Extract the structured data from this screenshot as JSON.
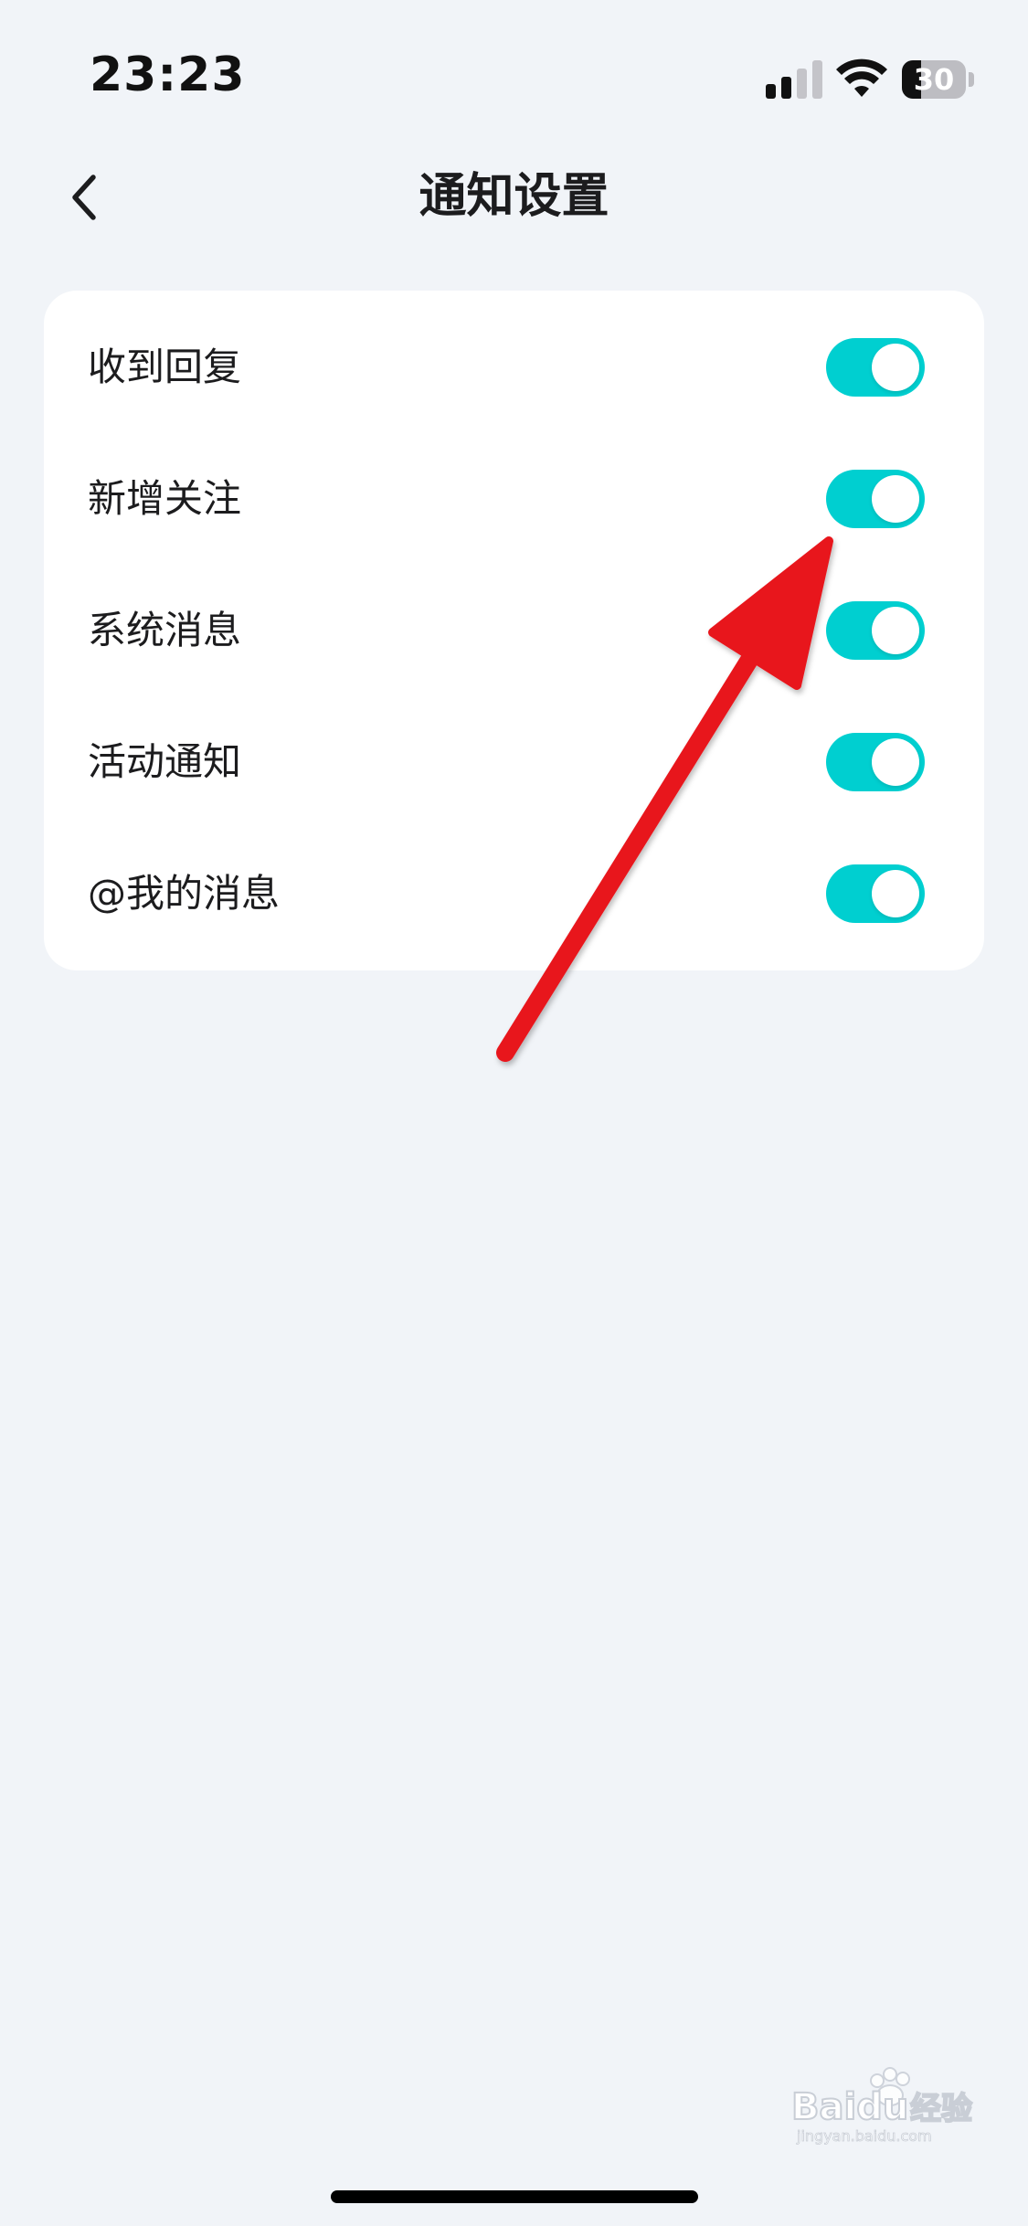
{
  "status_bar": {
    "time": "23:23",
    "battery_text": "30",
    "battery_level": 0.3,
    "signal_icon": "cellular-signal-icon",
    "wifi_icon": "wifi-icon"
  },
  "nav": {
    "back_icon": "chevron-left-icon",
    "title": "通知设置"
  },
  "settings": {
    "items": [
      {
        "label": "收到回复",
        "enabled": true
      },
      {
        "label": "新增关注",
        "enabled": true
      },
      {
        "label": "系统消息",
        "enabled": true
      },
      {
        "label": "活动通知",
        "enabled": true
      },
      {
        "label": "@我的消息",
        "enabled": true
      }
    ]
  },
  "colors": {
    "toggle_on": "#00cfd0",
    "toggle_off": "#e3e5e8",
    "background": "#f1f4f8",
    "annotation_arrow": "#e8191f"
  },
  "annotation": {
    "icon": "red-arrow-annotation",
    "points_to": "新增关注"
  },
  "watermark": {
    "brand": "Baidu",
    "cn": "经验",
    "url": "jingyan.baidu.com"
  }
}
